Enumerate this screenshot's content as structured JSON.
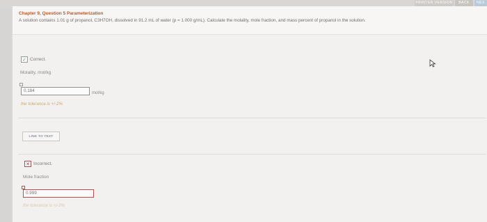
{
  "topbar": {
    "print_label": "PRINTER VERSION",
    "back_label": "BACK",
    "next_label": "NEX"
  },
  "question": {
    "title": "Chapter 9, Question 5 Parameterization",
    "text": "A solution contains 1.01 g of propanol, C3H7OH, dissolved in 91.2 mL of water (p = 1.000 g/mL). Calculate the molality, mole fraction, and mass percent of propanol in the solution."
  },
  "part1": {
    "status_icon": "check-icon",
    "status_text": "Correct.",
    "label": "Molality, mol/kg",
    "answer_value": "0.184",
    "unit": "mol/kg",
    "tolerance": "the tolerance is +/-2%"
  },
  "link_button": "LINK TO TEXT",
  "part2": {
    "status_icon": "x-icon",
    "status_text": "Incorrect.",
    "label": "Mole fraction",
    "answer_value": "0.999",
    "tolerance": "the tolerance is +/-2%"
  },
  "colors": {
    "title": "#b55a2e",
    "correct": "#6f8f6a",
    "incorrect": "#c24a4a",
    "tolerance": "#c9ab72"
  }
}
